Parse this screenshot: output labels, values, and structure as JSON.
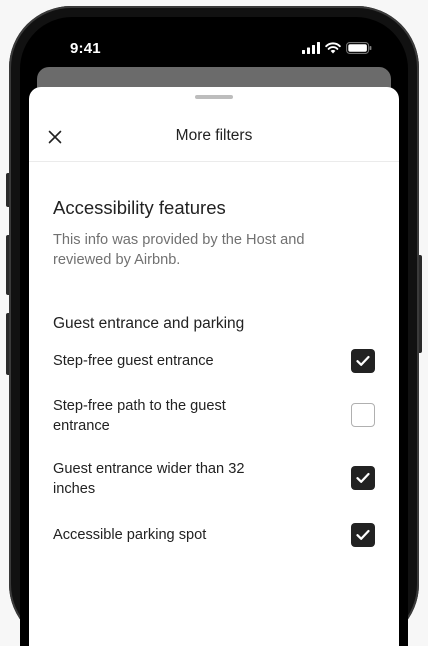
{
  "status_bar": {
    "time": "9:41"
  },
  "sheet": {
    "title": "More filters",
    "section_title": "Accessibility features",
    "section_description": "This info was provided by the Host and reviewed by Airbnb.",
    "group_title": "Guest entrance and parking",
    "options": [
      {
        "label": "Step-free guest entrance",
        "checked": true
      },
      {
        "label": "Step-free path to the guest entrance",
        "checked": false
      },
      {
        "label": "Guest entrance wider than 32 inches",
        "checked": true
      },
      {
        "label": "Accessible parking spot",
        "checked": true
      }
    ]
  },
  "icons": {
    "close": "close-icon",
    "check": "checkmark-icon",
    "signal": "cellular-signal-icon",
    "wifi": "wifi-icon",
    "battery": "battery-icon"
  },
  "colors": {
    "text_primary": "#222222",
    "text_secondary": "#717171",
    "checkbox_checked": "#222222",
    "checkbox_border": "#b0b0b0"
  }
}
